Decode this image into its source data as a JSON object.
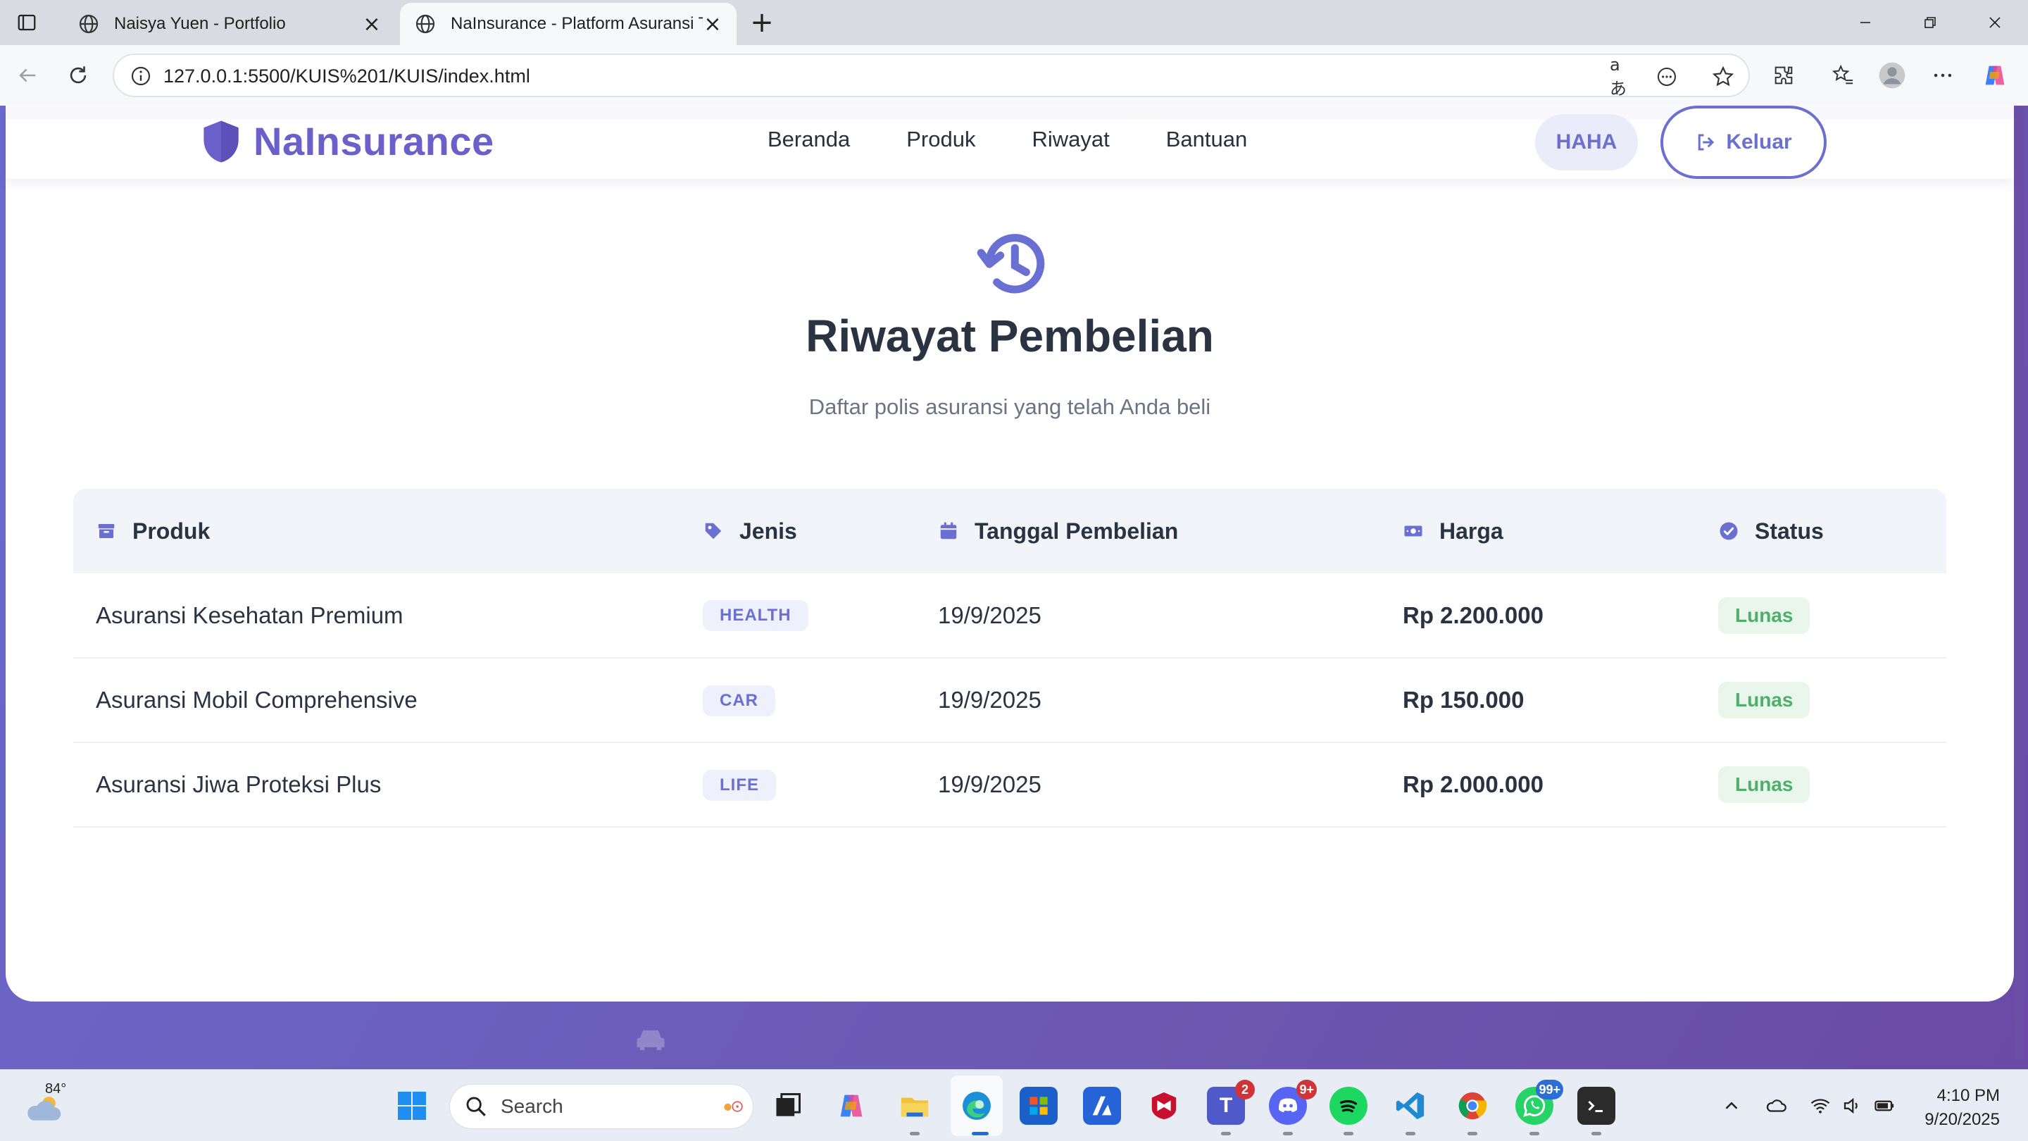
{
  "browser": {
    "tabs": [
      {
        "title": "Naisya Yuen - Portfolio",
        "active": false
      },
      {
        "title": "NaInsurance - Platform Asuransi T",
        "active": true
      }
    ],
    "url": "127.0.0.1:5500/KUIS%201/KUIS/index.html"
  },
  "header": {
    "brand": "NaInsurance",
    "nav": [
      "Beranda",
      "Produk",
      "Riwayat",
      "Bantuan"
    ],
    "user": "HAHA",
    "logout": "Keluar"
  },
  "page": {
    "title": "Riwayat Pembelian",
    "subtitle": "Daftar polis asuransi yang telah Anda beli"
  },
  "table": {
    "columns": [
      {
        "label": "Produk",
        "icon": "box-icon"
      },
      {
        "label": "Jenis",
        "icon": "tag-icon"
      },
      {
        "label": "Tanggal Pembelian",
        "icon": "calendar-icon"
      },
      {
        "label": "Harga",
        "icon": "money-icon"
      },
      {
        "label": "Status",
        "icon": "check-circle-icon"
      }
    ],
    "rows": [
      {
        "product": "Asuransi Kesehatan Premium",
        "type": "HEALTH",
        "date": "19/9/2025",
        "price": "Rp 2.200.000",
        "status": "Lunas"
      },
      {
        "product": "Asuransi Mobil Comprehensive",
        "type": "CAR",
        "date": "19/9/2025",
        "price": "Rp 150.000",
        "status": "Lunas"
      },
      {
        "product": "Asuransi Jiwa Proteksi Plus",
        "type": "LIFE",
        "date": "19/9/2025",
        "price": "Rp 2.000.000",
        "status": "Lunas"
      }
    ]
  },
  "taskbar": {
    "weather_temp": "84°",
    "search_label": "Search",
    "teams_badge": "2",
    "discord_badge": "9+",
    "whatsapp_badge": "99+",
    "time": "4:10 PM",
    "date": "9/20/2025"
  },
  "colors": {
    "accent": "#6c6fd2",
    "brand": "#6b5fc9",
    "success": "#4fae6b",
    "background_gradient_start": "#6a6ad0",
    "background_gradient_end": "#6a4aa6"
  }
}
